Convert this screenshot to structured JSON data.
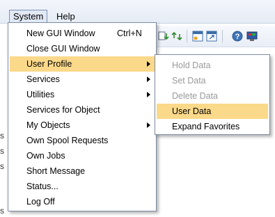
{
  "menubar": {
    "system": "System",
    "help": "Help"
  },
  "left_edge": [
    "s",
    "s",
    "s",
    "s"
  ],
  "system_menu": {
    "items": [
      {
        "label": "New GUI Window",
        "shortcut": "Ctrl+N"
      },
      {
        "label": "Close GUI Window"
      },
      {
        "label": "User Profile",
        "submenu": true,
        "highlighted": true
      },
      {
        "label": "Services",
        "submenu": true
      },
      {
        "label": "Utilities",
        "submenu": true
      },
      {
        "label": "Services for Object"
      },
      {
        "label": "My Objects",
        "submenu": true
      },
      {
        "label": "Own Spool Requests"
      },
      {
        "label": "Own Jobs"
      },
      {
        "label": "Short Message"
      },
      {
        "label": "Status..."
      },
      {
        "label": "Log Off"
      }
    ]
  },
  "user_profile_menu": {
    "items": [
      {
        "label": "Hold Data",
        "enabled": false
      },
      {
        "label": "Set Data",
        "enabled": false
      },
      {
        "label": "Delete Data",
        "enabled": false
      },
      {
        "label": "User Data",
        "enabled": true,
        "highlighted": true
      },
      {
        "label": "Expand Favorites",
        "enabled": true
      }
    ]
  },
  "toolbar": {
    "icons": [
      "download-icon",
      "upload-icon",
      "layout-icon",
      "new-session-icon",
      "help-icon",
      "customize-icon"
    ]
  },
  "colors": {
    "highlight": "#fbd98a",
    "menu_border": "#7d8aa0",
    "disabled_text": "#9a9a9a",
    "menubar_bg": "#e6ecf5"
  }
}
